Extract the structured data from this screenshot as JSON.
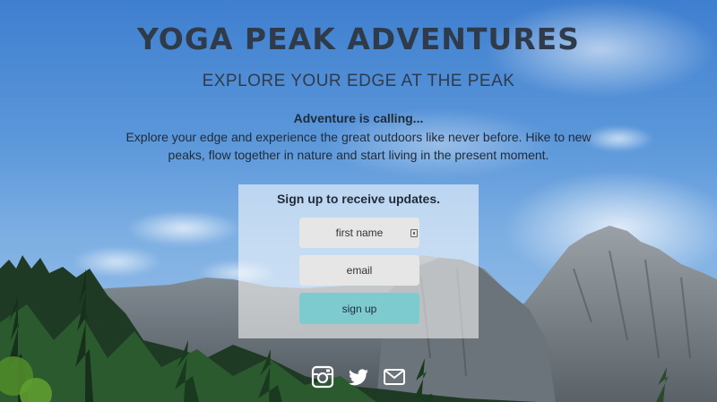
{
  "header": {
    "title": "YOGA PEAK ADVENTURES",
    "subtitle": "EXPLORE YOUR EDGE AT THE PEAK"
  },
  "intro": {
    "heading": "Adventure is calling...",
    "body": "Explore your edge and experience the great outdoors like never before. Hike to new peaks, flow together in nature and start living in the present moment."
  },
  "signup": {
    "heading": "Sign up to receive updates.",
    "first_name_placeholder": "first name",
    "email_placeholder": "email",
    "button_label": "sign up"
  },
  "social": {
    "icons": [
      "instagram-icon",
      "twitter-icon",
      "email-icon"
    ]
  },
  "colors": {
    "text": "#2f3b4a",
    "button": "#7ecbcf",
    "field": "#e6e6e6",
    "panel": "rgba(255,255,255,0.55)"
  }
}
